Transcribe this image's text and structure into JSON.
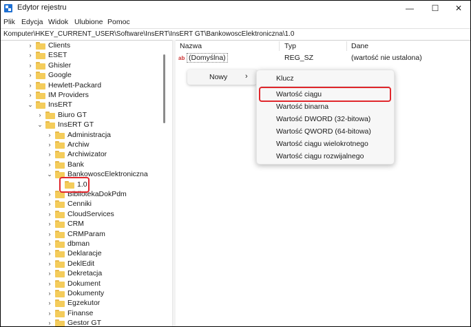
{
  "window": {
    "title": "Edytor rejestru",
    "minimize": "—",
    "maximize": "☐",
    "close": "✕"
  },
  "menu": [
    "Plik",
    "Edycja",
    "Widok",
    "Ulubione",
    "Pomoc"
  ],
  "address": "Komputer\\HKEY_CURRENT_USER\\Software\\InsERT\\InsERT GT\\BankowoscElektroniczna\\1.0",
  "tree": [
    {
      "label": "Clients",
      "level": 0,
      "chev": "›"
    },
    {
      "label": "ESET",
      "level": 0,
      "chev": "›"
    },
    {
      "label": "Ghisler",
      "level": 0,
      "chev": "›"
    },
    {
      "label": "Google",
      "level": 0,
      "chev": "›"
    },
    {
      "label": "Hewlett-Packard",
      "level": 0,
      "chev": "›"
    },
    {
      "label": "IM Providers",
      "level": 0,
      "chev": "›"
    },
    {
      "label": "InsERT",
      "level": 0,
      "chev": "⌄"
    },
    {
      "label": "Biuro GT",
      "level": 1,
      "chev": "›"
    },
    {
      "label": "InsERT GT",
      "level": 1,
      "chev": "⌄"
    },
    {
      "label": "Administracja",
      "level": 2,
      "chev": "›"
    },
    {
      "label": "Archiw",
      "level": 2,
      "chev": "›"
    },
    {
      "label": "Archiwizator",
      "level": 2,
      "chev": "›"
    },
    {
      "label": "Bank",
      "level": 2,
      "chev": "›"
    },
    {
      "label": "BankowoscElektroniczna",
      "level": 2,
      "chev": "⌄"
    },
    {
      "label": "1.0",
      "level": 3,
      "chev": ""
    },
    {
      "label": "BibliotekaDokPdm",
      "level": 2,
      "chev": "›"
    },
    {
      "label": "Cenniki",
      "level": 2,
      "chev": "›"
    },
    {
      "label": "CloudServices",
      "level": 2,
      "chev": "›"
    },
    {
      "label": "CRM",
      "level": 2,
      "chev": "›"
    },
    {
      "label": "CRMParam",
      "level": 2,
      "chev": "›"
    },
    {
      "label": "dbman",
      "level": 2,
      "chev": "›"
    },
    {
      "label": "Deklaracje",
      "level": 2,
      "chev": "›"
    },
    {
      "label": "DeklEdit",
      "level": 2,
      "chev": "›"
    },
    {
      "label": "Dekretacja",
      "level": 2,
      "chev": "›"
    },
    {
      "label": "Dokument",
      "level": 2,
      "chev": "›"
    },
    {
      "label": "Dokumenty",
      "level": 2,
      "chev": "›"
    },
    {
      "label": "Egzekutor",
      "level": 2,
      "chev": "›"
    },
    {
      "label": "Finanse",
      "level": 2,
      "chev": "›"
    },
    {
      "label": "Gestor GT",
      "level": 2,
      "chev": "›"
    }
  ],
  "columns": {
    "name": "Nazwa",
    "type": "Typ",
    "data": "Dane"
  },
  "values": [
    {
      "name": "(Domyślna)",
      "type": "REG_SZ",
      "data": "(wartość nie ustalona)",
      "icon": "ab"
    }
  ],
  "context_menu": {
    "item": "Nowy",
    "arrow": "›"
  },
  "submenu": [
    "Klucz",
    "Wartość ciągu",
    "Wartość binarna",
    "Wartość DWORD (32-bitowa)",
    "Wartość QWORD (64-bitowa)",
    "Wartość ciągu wielokrotnego",
    "Wartość ciągu rozwijalnego"
  ],
  "accent": "#e0262b"
}
